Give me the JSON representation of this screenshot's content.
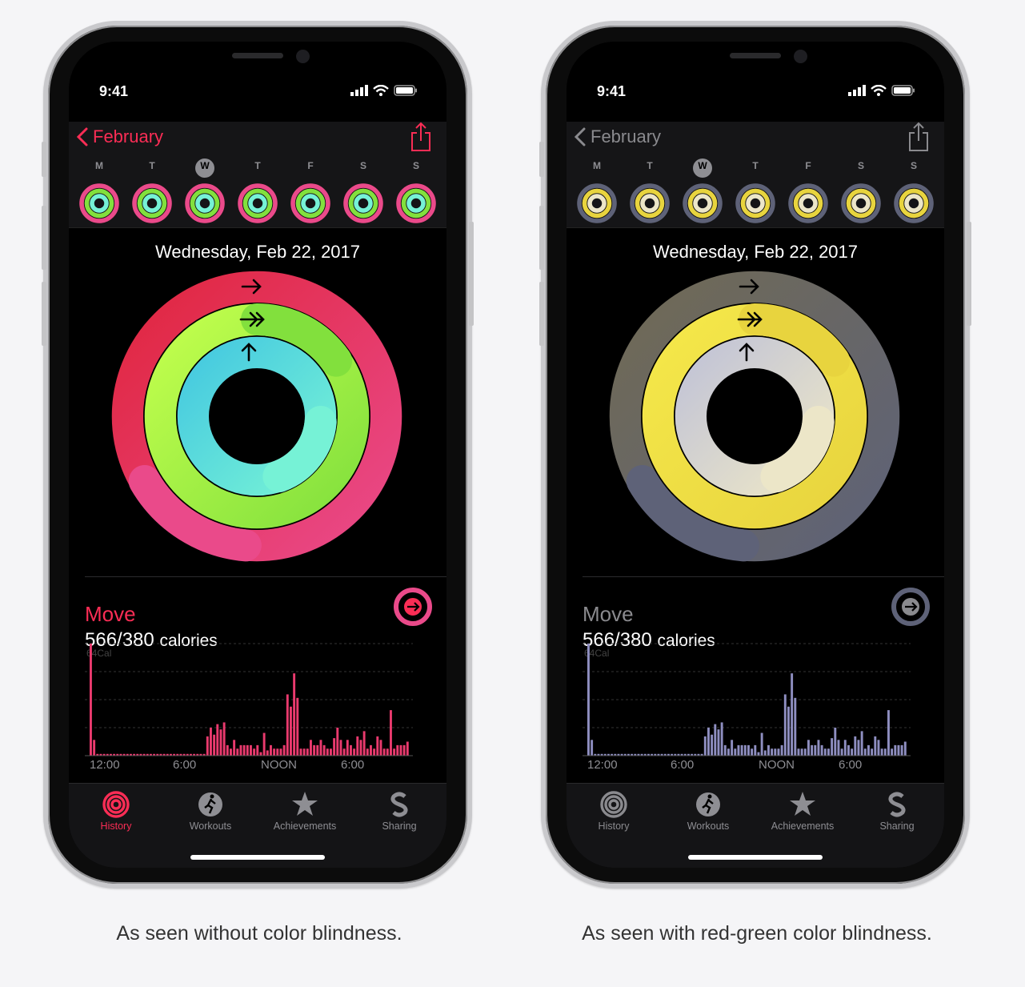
{
  "captions": {
    "normal": "As seen without color blindness.",
    "colorblind": "As seen with red-green color blindness."
  },
  "phone": {
    "time": "9:41",
    "nav_back_label": "February",
    "week_days": [
      "M",
      "T",
      "W",
      "T",
      "F",
      "S",
      "S"
    ],
    "today_index": 2,
    "date_title": "Wednesday, Feb 22, 2017",
    "move": {
      "label": "Move",
      "value": "566/380",
      "unit": "calories"
    },
    "chart_axis": {
      "max_label": "64Cal",
      "x_labels": [
        "12:00",
        "6:00",
        "NOON",
        "6:00"
      ]
    },
    "tabs": [
      {
        "label": "History",
        "icon": "history-rings-icon"
      },
      {
        "label": "Workouts",
        "icon": "runner-icon"
      },
      {
        "label": "Achievements",
        "icon": "star-badge-icon"
      },
      {
        "label": "Sharing",
        "icon": "sharing-s-icon"
      }
    ],
    "icons": [
      "chevron-left-icon",
      "share-icon",
      "signal-bars-icon",
      "wifi-icon",
      "battery-icon",
      "arrow-right-icon"
    ]
  },
  "chart_data": {
    "type": "bar",
    "x": [
      "12:00",
      "12:15",
      "12:30",
      "12:45",
      "1:00",
      "1:15",
      "1:30",
      "1:45",
      "2:00",
      "2:15",
      "2:30",
      "2:45",
      "3:00",
      "3:15",
      "3:30",
      "3:45",
      "4:00",
      "4:15",
      "4:30",
      "4:45",
      "5:00",
      "5:15",
      "5:30",
      "5:45",
      "6:00",
      "6:15",
      "6:30",
      "6:45",
      "7:00",
      "7:15",
      "7:30",
      "7:45",
      "8:00",
      "8:15",
      "8:30",
      "8:45",
      "9:00",
      "9:15",
      "9:30",
      "9:45",
      "10:00",
      "10:15",
      "10:30",
      "10:45",
      "11:00",
      "11:15",
      "11:30",
      "11:45",
      "12:00",
      "12:15",
      "12:30",
      "12:45",
      "1:00",
      "1:15",
      "1:30",
      "1:45",
      "2:00",
      "2:15",
      "2:30",
      "2:45",
      "3:00",
      "3:15",
      "3:30",
      "3:45",
      "4:00",
      "4:15",
      "4:30",
      "4:45",
      "5:00",
      "5:15",
      "5:30",
      "5:45",
      "6:00",
      "6:15",
      "6:30",
      "6:45",
      "7:00",
      "7:15",
      "7:30",
      "7:45",
      "8:00",
      "8:15",
      "8:30",
      "8:45",
      "9:00",
      "9:15",
      "9:30",
      "9:45",
      "10:00",
      "10:15",
      "10:30",
      "10:45",
      "11:00",
      "11:15",
      "11:30",
      "11:45"
    ],
    "values": [
      64,
      9,
      1,
      1,
      1,
      1,
      1,
      1,
      1,
      1,
      1,
      1,
      1,
      1,
      1,
      1,
      1,
      1,
      1,
      1,
      1,
      1,
      1,
      1,
      1,
      1,
      1,
      1,
      1,
      1,
      1,
      1,
      1,
      1,
      1,
      11,
      16,
      12,
      18,
      15,
      19,
      6,
      4,
      9,
      4,
      6,
      6,
      6,
      6,
      4,
      6,
      2,
      13,
      3,
      6,
      4,
      4,
      4,
      6,
      35,
      28,
      47,
      33,
      4,
      4,
      4,
      9,
      6,
      6,
      9,
      6,
      4,
      4,
      10,
      16,
      9,
      4,
      9,
      6,
      4,
      11,
      9,
      14,
      4,
      6,
      4,
      11,
      9,
      4,
      4,
      26,
      4,
      6,
      6,
      6,
      8
    ],
    "ylim": [
      0,
      64
    ],
    "ylabel": "",
    "xlabel": "",
    "x_tick_labels": [
      "12:00",
      "6:00",
      "NOON",
      "6:00"
    ]
  },
  "themes": {
    "normal": {
      "accent": "#fa2d55",
      "move_ring": [
        "#e0263f",
        "#ea4a8a"
      ],
      "exercise_ring": [
        "#c3ff4d",
        "#82e03d"
      ],
      "stand_ring": [
        "#45c9e0",
        "#76f2d6"
      ],
      "bar": "#ea3a6e",
      "axis_label": "#8e8e93"
    },
    "colorblind": {
      "accent": "#8a8a8e",
      "move_ring": [
        "#706a55",
        "#5e6278"
      ],
      "exercise_ring": [
        "#f5e84a",
        "#e8d43e"
      ],
      "stand_ring": [
        "#c2c4d6",
        "#ece6c8"
      ],
      "bar": "#8e8ec0",
      "axis_label": "#8e8e93"
    }
  }
}
